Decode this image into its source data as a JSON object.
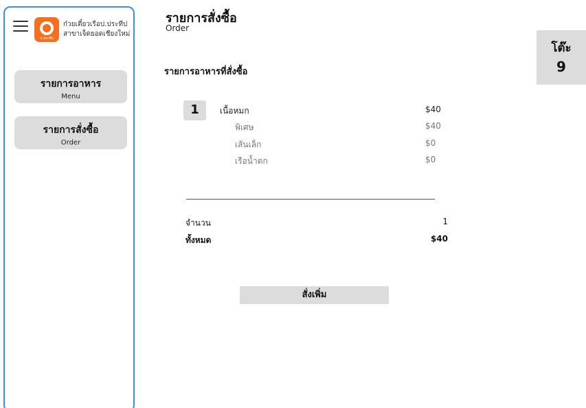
{
  "sidebar": {
    "brand_line1": "ก๋วยเตี๋ยวเรือป.ประทีป",
    "brand_line2": "สาขาเจ็ดยอดเชียงใหม่",
    "logo_text": "ป.ประทีป",
    "nav": [
      {
        "label": "รายการอาหาร",
        "sub": "Menu"
      },
      {
        "label": "รายการสั่งซื้อ",
        "sub": "Order"
      }
    ]
  },
  "header": {
    "title": "รายการสั่งซื้อ",
    "subtitle": "Order"
  },
  "table": {
    "label": "โต๊ะ",
    "number": "9"
  },
  "section_title": "รายการอาหารที่สั่งซื้อ",
  "order": {
    "items": [
      {
        "qty": "1",
        "name": "เนื้อหมก",
        "price": "$40",
        "options": [
          {
            "name": "พิเศษ",
            "price": "$40"
          },
          {
            "name": "เส้นเล็ก",
            "price": "$0"
          },
          {
            "name": "เรือน้ำตก",
            "price": "$0"
          }
        ]
      }
    ]
  },
  "summary": {
    "qty_label": "จำนวน",
    "qty_value": "1",
    "total_label": "ทั้งหมด",
    "total_value": "$40"
  },
  "actions": {
    "order_more": "สั่งเพิ่ม"
  },
  "colors": {
    "sidebar_border": "#3b8fe0",
    "button_bg": "#dcdcdc",
    "logo_bg": "#f36f21"
  }
}
